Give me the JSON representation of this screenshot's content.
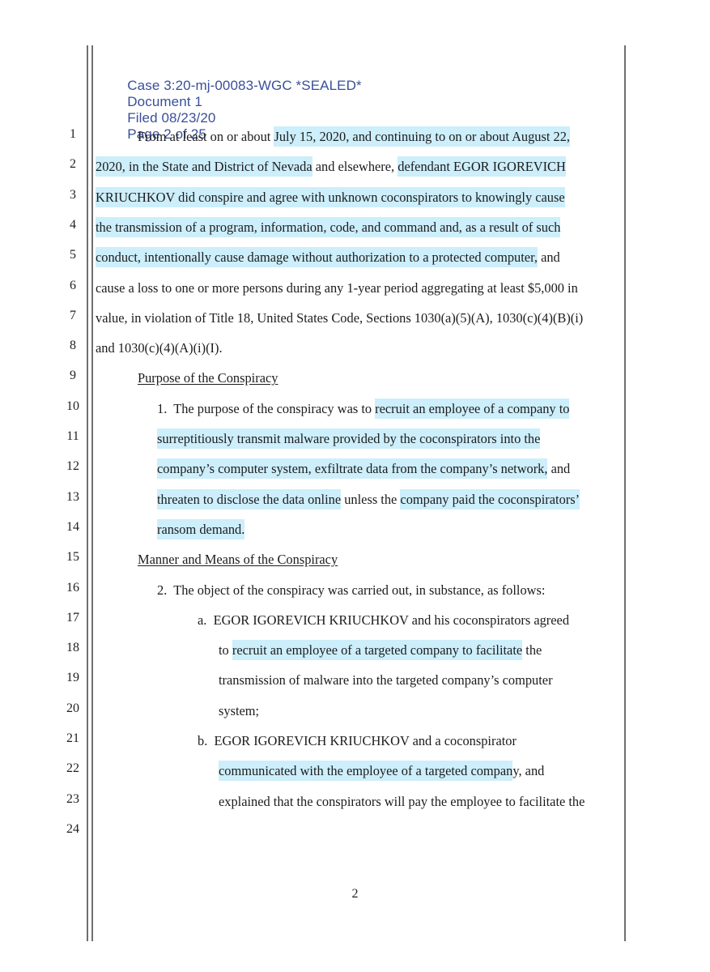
{
  "header": {
    "case": "Case 3:20-mj-00083-WGC *SEALED*",
    "document": "Document 1",
    "filed": "Filed 08/23/20",
    "page": "Page 2 of 25"
  },
  "line_numbers": [
    "1",
    "2",
    "3",
    "4",
    "5",
    "6",
    "7",
    "8",
    "9",
    "10",
    "11",
    "12",
    "13",
    "14",
    "15",
    "16",
    "17",
    "18",
    "19",
    "20",
    "21",
    "22",
    "23",
    "24"
  ],
  "lines": [
    {
      "segments": [
        {
          "t": "From at least on or about ",
          "h": false
        },
        {
          "t": "July 15, 2020, and continuing to on or about August 22,",
          "h": true
        }
      ]
    },
    {
      "segments": [
        {
          "t": "2020, in the State and District of Nevada",
          "h": true
        },
        {
          "t": " and elsewhere, ",
          "h": false
        },
        {
          "t": "defendant EGOR IGOREVICH",
          "h": true
        }
      ]
    },
    {
      "segments": [
        {
          "t": "KRIUCHKOV did conspire and agree with unknown coconspirators to knowingly cause",
          "h": true
        }
      ]
    },
    {
      "segments": [
        {
          "t": "the transmission of a program, information, code, and command and, as a result of such",
          "h": true
        }
      ]
    },
    {
      "segments": [
        {
          "t": "conduct, intentionally cause damage without authorization to a protected computer,",
          "h": true
        },
        {
          "t": " and",
          "h": false
        }
      ]
    },
    {
      "segments": [
        {
          "t": "cause a loss to one or more persons during any 1-year period aggregating at least $5,000 in",
          "h": false
        }
      ]
    },
    {
      "segments": [
        {
          "t": "value, in violation of Title 18, United States Code, Sections 1030(a)(5)(A), 1030(c)(4)(B)(i)",
          "h": false
        }
      ]
    },
    {
      "segments": [
        {
          "t": "and 1030(c)(4)(A)(i)(I).",
          "h": false
        }
      ]
    },
    {
      "segments": [
        {
          "t": "Purpose of the Conspiracy",
          "h": false,
          "u": true
        }
      ]
    },
    {
      "segments": [
        {
          "t": "1.  The purpose of the conspiracy was to ",
          "h": false
        },
        {
          "t": "recruit an employee of a company to",
          "h": true
        }
      ]
    },
    {
      "segments": [
        {
          "t": "surreptitiously transmit malware provided by the coconspirators into the",
          "h": true
        }
      ]
    },
    {
      "segments": [
        {
          "t": "company’s computer system, exfiltrate data from the company’s network,",
          "h": true
        },
        {
          "t": " and",
          "h": false
        }
      ]
    },
    {
      "segments": [
        {
          "t": "threaten to disclose the data online",
          "h": true
        },
        {
          "t": " unless the ",
          "h": false
        },
        {
          "t": "company paid the coconspirators’",
          "h": true
        }
      ]
    },
    {
      "segments": [
        {
          "t": "ransom demand.",
          "h": true
        }
      ]
    },
    {
      "segments": [
        {
          "t": "Manner and Means of the Conspiracy",
          "h": false,
          "u": true
        }
      ]
    },
    {
      "segments": [
        {
          "t": "2.  The object of the conspiracy was carried out, in substance, as follows:",
          "h": false
        }
      ]
    },
    {
      "segments": [
        {
          "t": "a.  EGOR IGOREVICH KRIUCHKOV and his coconspirators agreed",
          "h": false
        }
      ]
    },
    {
      "segments": [
        {
          "t": "to ",
          "h": false
        },
        {
          "t": "recruit an employee of a targeted company to facilitate",
          "h": true
        },
        {
          "t": " the",
          "h": false
        }
      ]
    },
    {
      "segments": [
        {
          "t": "transmission of malware into the targeted company’s computer",
          "h": false
        }
      ]
    },
    {
      "segments": [
        {
          "t": "system;",
          "h": false
        }
      ]
    },
    {
      "segments": [
        {
          "t": "b.  EGOR IGOREVICH KRIUCHKOV and a coconspirator",
          "h": false
        }
      ]
    },
    {
      "segments": [
        {
          "t": "communicated with the employee of a targeted compan",
          "h": true
        },
        {
          "t": "y, and",
          "h": false
        }
      ]
    },
    {
      "segments": [
        {
          "t": "explained that the conspirators will pay the employee to facilitate the",
          "h": false
        }
      ]
    },
    {
      "segments": []
    }
  ],
  "footer": {
    "page_number": "2"
  },
  "colors": {
    "header_text": "#3a4f9a",
    "highlight": "#cdeefb",
    "margin_rule": "#6f6f6f"
  }
}
